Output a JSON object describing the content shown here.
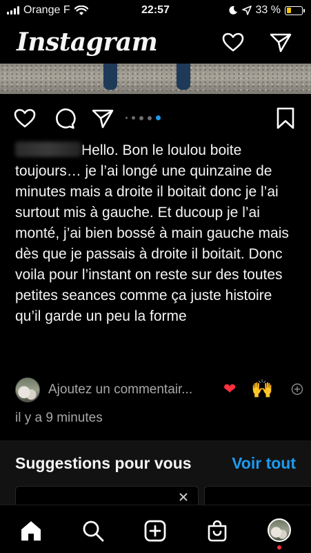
{
  "status_bar": {
    "carrier": "Orange F",
    "time": "22:57",
    "battery_percent": "33 %",
    "battery_level": 0.33
  },
  "header": {
    "logo": "Instagram"
  },
  "post": {
    "carousel_dot_count": 5,
    "carousel_active_index": 4,
    "caption": "Hello. Bon le loulou boite toujours… je l’ai longé une quinzaine de minutes mais a droite il boitait donc je l’ai surtout mis à gauche. Et ducoup je l’ai monté, j’ai bien bossé à main gauche mais dès que je passais à droite il boitait. Donc voila pour l’instant on reste sur des toutes petites seances comme ça juste histoire qu’il garde un peu la forme",
    "comment_placeholder": "Ajoutez un commentair...",
    "quick_reaction_1": "❤",
    "quick_reaction_2": "🙌",
    "timestamp": "il y a 9 minutes"
  },
  "suggestions": {
    "title": "Suggestions pour vous",
    "see_all": "Voir tout"
  },
  "tab_bar": {
    "items": [
      "home-icon",
      "search-icon",
      "create-icon",
      "shop-icon",
      "profile-avatar"
    ]
  },
  "colors": {
    "background": "#000000",
    "accent_blue": "#1e9bf0",
    "battery_yellow": "#f5c400",
    "notification_red": "#ff3040",
    "secondary_text": "#a8a8a8"
  }
}
